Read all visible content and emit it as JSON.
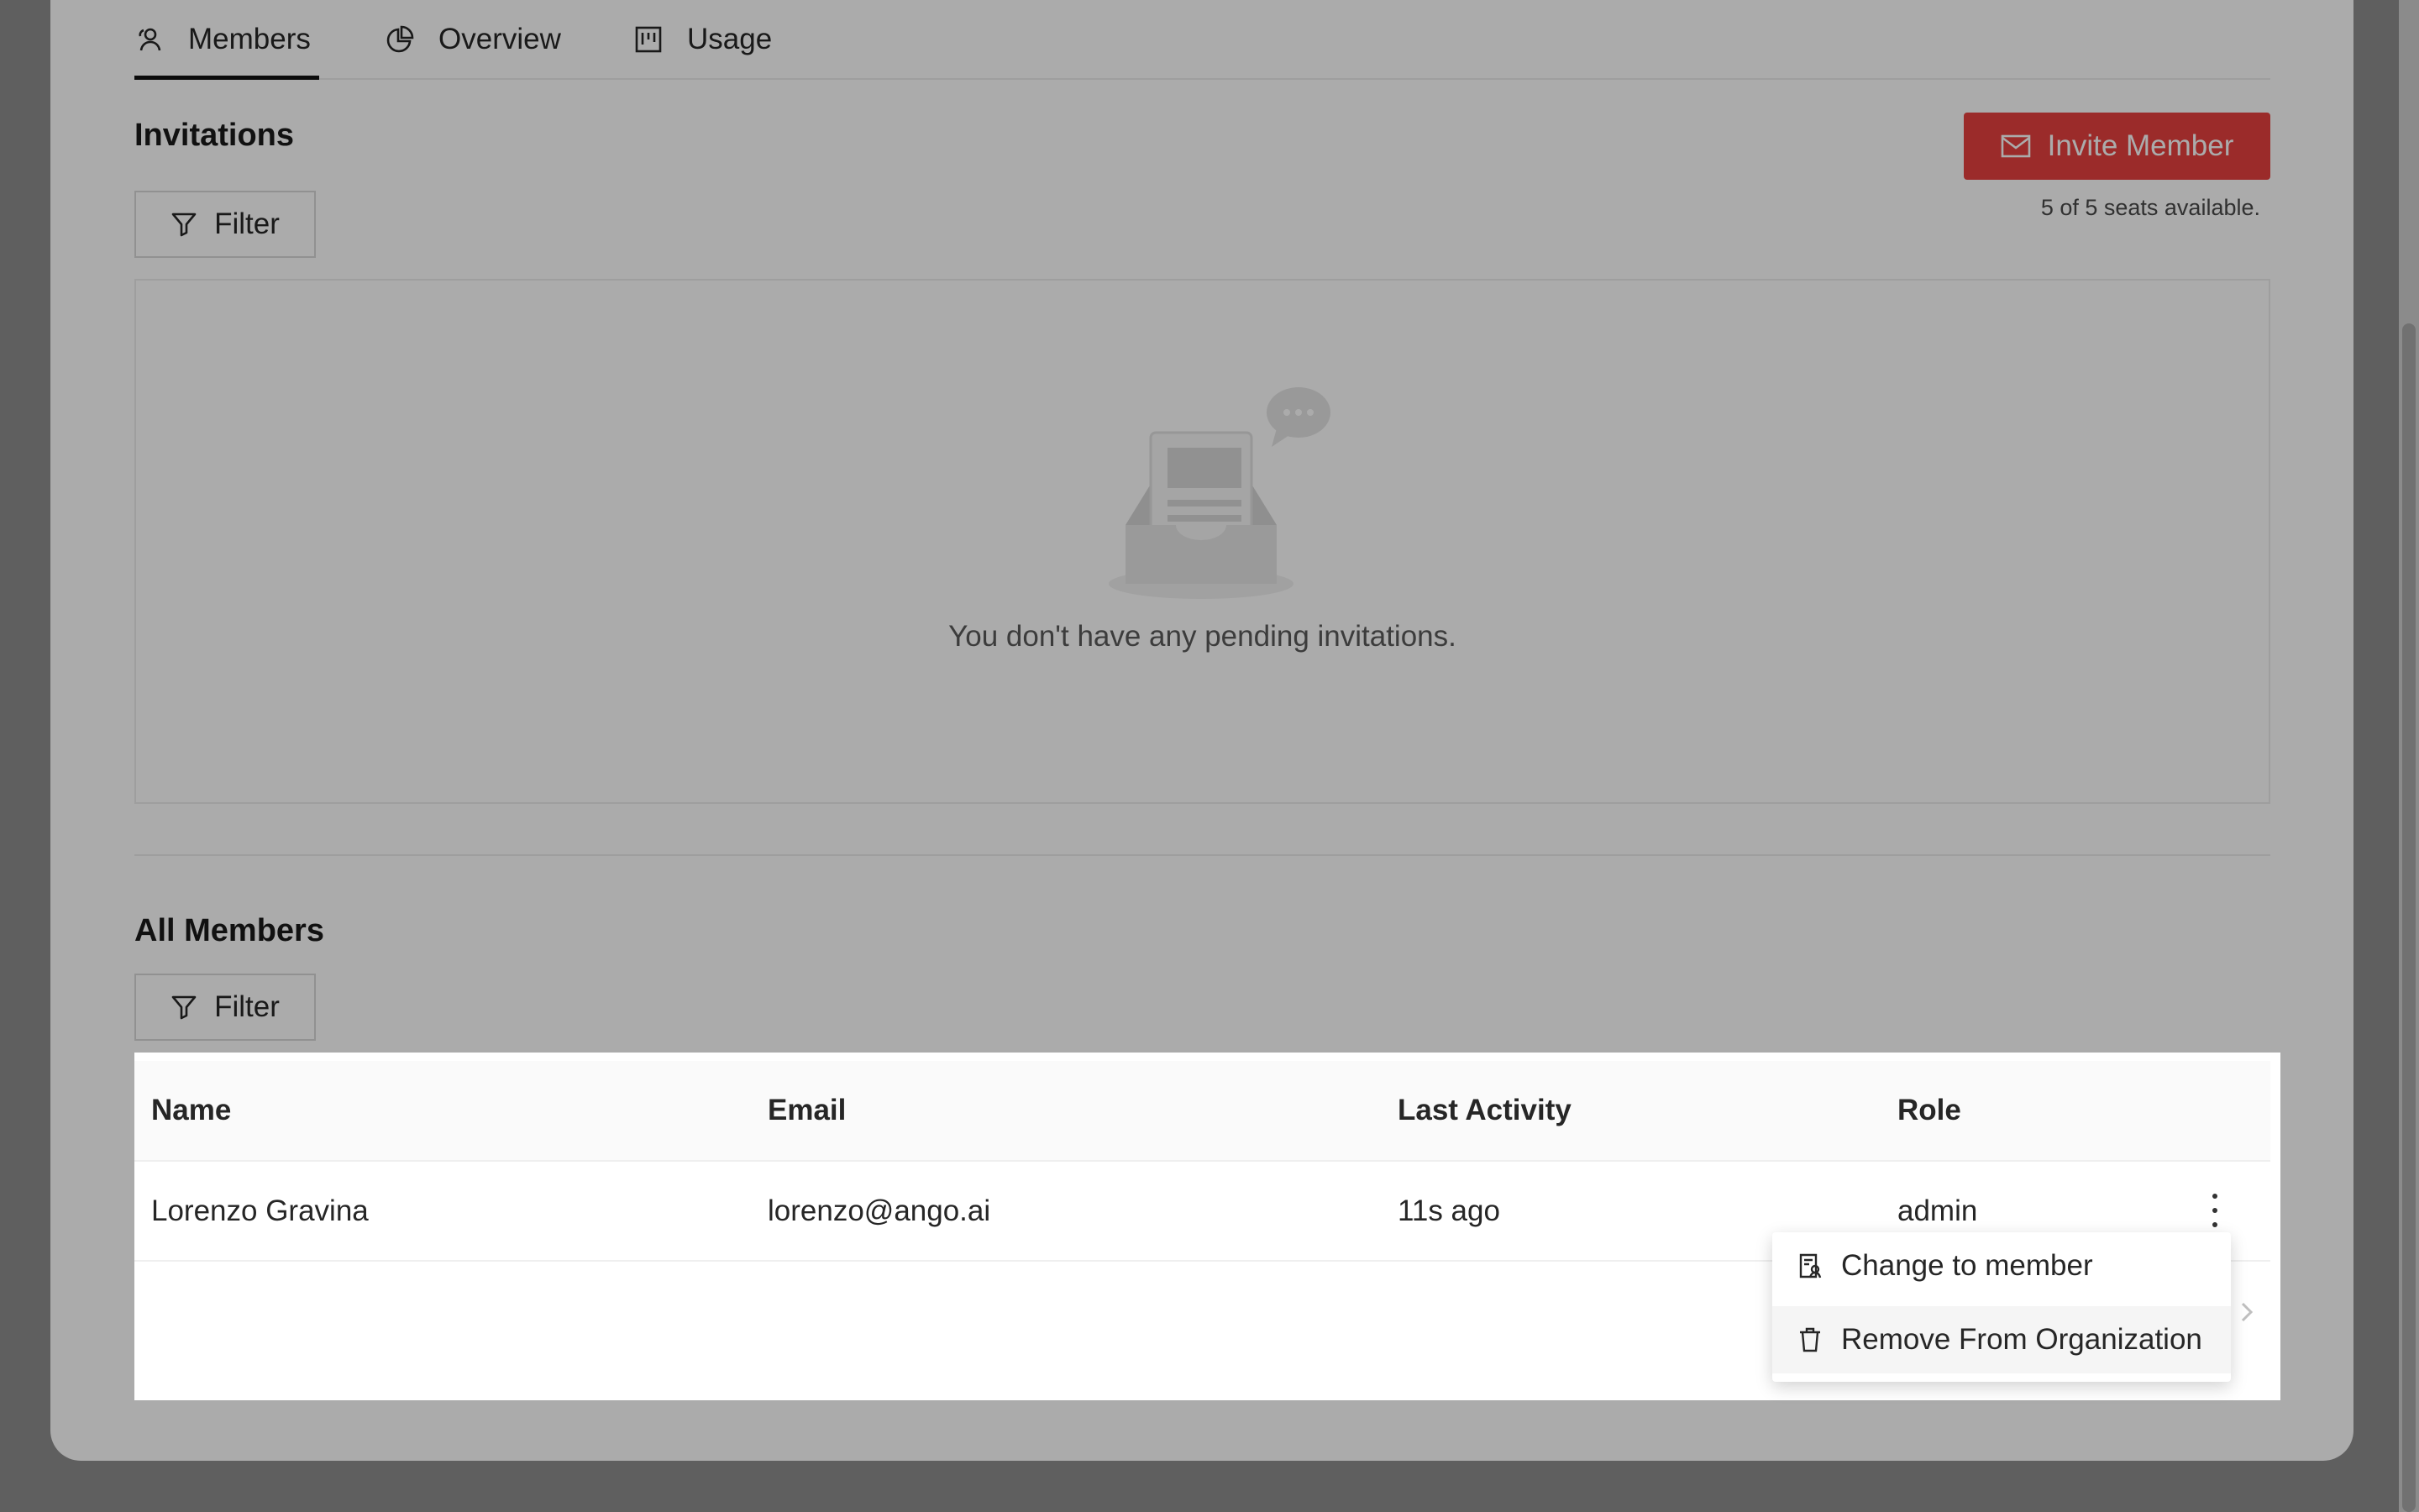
{
  "tabs": [
    {
      "label": "Members",
      "icon": "members-icon",
      "active": true
    },
    {
      "label": "Overview",
      "icon": "pie-chart-icon",
      "active": false
    },
    {
      "label": "Usage",
      "icon": "usage-board-icon",
      "active": false
    }
  ],
  "invitations": {
    "title": "Invitations",
    "filter_label": "Filter",
    "invite_button": "Invite Member",
    "seats_text": "5 of 5 seats available.",
    "empty_text": "You don't have any pending invitations."
  },
  "members": {
    "title": "All Members",
    "filter_label": "Filter",
    "columns": [
      "Name",
      "Email",
      "Last Activity",
      "Role"
    ],
    "rows": [
      {
        "name": "Lorenzo Gravina",
        "email": "lorenzo@ango.ai",
        "last_activity": "11s ago",
        "role": "admin"
      }
    ]
  },
  "row_menu": {
    "items": [
      {
        "label": "Change to member",
        "icon": "change-role-icon"
      },
      {
        "label": "Remove From Organization",
        "icon": "trash-icon"
      }
    ]
  },
  "colors": {
    "accent": "#e8413f",
    "overlay": "rgba(0,0,0,0.33)"
  }
}
